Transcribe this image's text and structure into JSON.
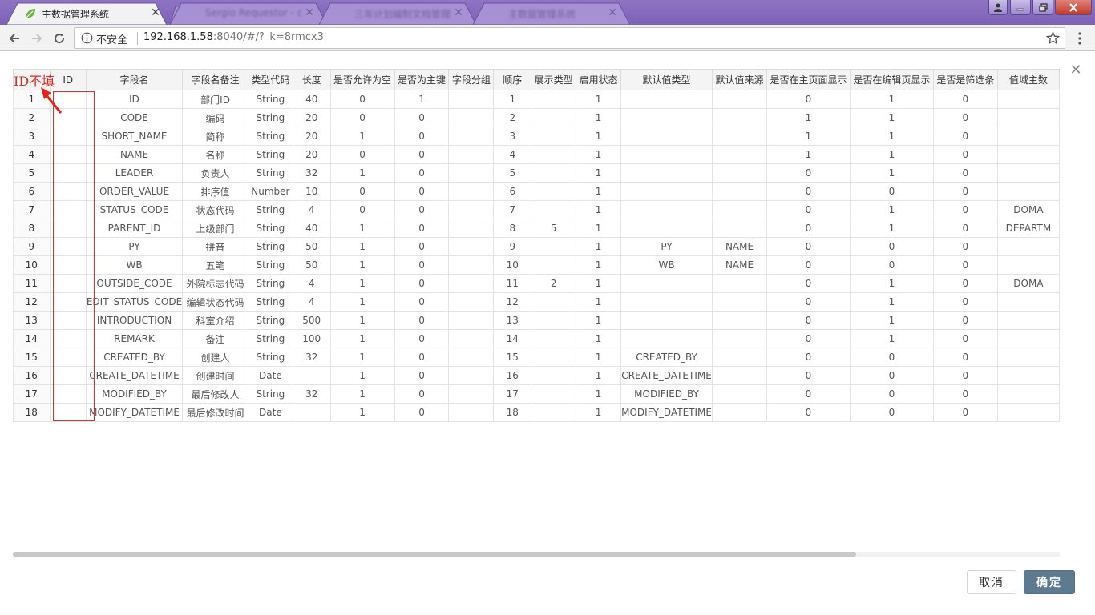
{
  "browser": {
    "tabs": [
      {
        "title": "主数据管理系统",
        "active": true
      },
      {
        "title": "Sergio Requestor - dev",
        "active": false
      },
      {
        "title": "三年计划编制文档管理",
        "active": false
      },
      {
        "title": "主数据管理系统",
        "active": false
      }
    ],
    "security_label": "不安全",
    "url_host": "192.168.1.58",
    "url_rest": ":8040/#/?_k=8rmcx3"
  },
  "annotation": {
    "text": "ID不填",
    "color": "#e0261f"
  },
  "table": {
    "columns": [
      "",
      "ID",
      "字段名",
      "字段名备注",
      "类型代码",
      "长度",
      "是否允许为空",
      "是否为主键",
      "字段分组",
      "顺序",
      "展示类型",
      "启用状态",
      "默认值类型",
      "默认值来源",
      "是否在主页面显示",
      "是否在编辑页显示",
      "是否是筛选条",
      "值域主数"
    ],
    "rows": [
      [
        "1",
        "",
        "ID",
        "部门ID",
        "String",
        "40",
        "0",
        "1",
        "",
        "1",
        "",
        "1",
        "",
        "",
        "0",
        "1",
        "0",
        ""
      ],
      [
        "2",
        "",
        "CODE",
        "编码",
        "String",
        "20",
        "0",
        "0",
        "",
        "2",
        "",
        "1",
        "",
        "",
        "1",
        "1",
        "0",
        ""
      ],
      [
        "3",
        "",
        "SHORT_NAME",
        "简称",
        "String",
        "20",
        "1",
        "0",
        "",
        "3",
        "",
        "1",
        "",
        "",
        "1",
        "1",
        "0",
        ""
      ],
      [
        "4",
        "",
        "NAME",
        "名称",
        "String",
        "20",
        "0",
        "0",
        "",
        "4",
        "",
        "1",
        "",
        "",
        "1",
        "1",
        "0",
        ""
      ],
      [
        "5",
        "",
        "LEADER",
        "负责人",
        "String",
        "32",
        "1",
        "0",
        "",
        "5",
        "",
        "1",
        "",
        "",
        "0",
        "1",
        "0",
        ""
      ],
      [
        "6",
        "",
        "ORDER_VALUE",
        "排序值",
        "Number",
        "10",
        "0",
        "0",
        "",
        "6",
        "",
        "1",
        "",
        "",
        "0",
        "0",
        "0",
        ""
      ],
      [
        "7",
        "",
        "STATUS_CODE",
        "状态代码",
        "String",
        "4",
        "0",
        "0",
        "",
        "7",
        "",
        "1",
        "",
        "",
        "0",
        "1",
        "0",
        "DOMA"
      ],
      [
        "8",
        "",
        "PARENT_ID",
        "上级部门",
        "String",
        "40",
        "1",
        "0",
        "",
        "8",
        "5",
        "1",
        "",
        "",
        "0",
        "1",
        "0",
        "DEPARTM"
      ],
      [
        "9",
        "",
        "PY",
        "拼音",
        "String",
        "50",
        "1",
        "0",
        "",
        "9",
        "",
        "1",
        "PY",
        "NAME",
        "0",
        "0",
        "0",
        ""
      ],
      [
        "10",
        "",
        "WB",
        "五笔",
        "String",
        "50",
        "1",
        "0",
        "",
        "10",
        "",
        "1",
        "WB",
        "NAME",
        "0",
        "0",
        "0",
        ""
      ],
      [
        "11",
        "",
        "OUTSIDE_CODE",
        "外院标志代码",
        "String",
        "4",
        "1",
        "0",
        "",
        "11",
        "2",
        "1",
        "",
        "",
        "0",
        "1",
        "0",
        "DOMA"
      ],
      [
        "12",
        "",
        "EDIT_STATUS_CODE",
        "编辑状态代码",
        "String",
        "4",
        "1",
        "0",
        "",
        "12",
        "",
        "1",
        "",
        "",
        "0",
        "1",
        "0",
        ""
      ],
      [
        "13",
        "",
        "INTRODUCTION",
        "科室介绍",
        "String",
        "500",
        "1",
        "0",
        "",
        "13",
        "",
        "1",
        "",
        "",
        "0",
        "1",
        "0",
        ""
      ],
      [
        "14",
        "",
        "REMARK",
        "备注",
        "String",
        "100",
        "1",
        "0",
        "",
        "14",
        "",
        "1",
        "",
        "",
        "0",
        "1",
        "0",
        ""
      ],
      [
        "15",
        "",
        "CREATED_BY",
        "创建人",
        "String",
        "32",
        "1",
        "0",
        "",
        "15",
        "",
        "1",
        "CREATED_BY",
        "",
        "0",
        "0",
        "0",
        ""
      ],
      [
        "16",
        "",
        "CREATE_DATETIME",
        "创建时间",
        "Date",
        "",
        "1",
        "0",
        "",
        "16",
        "",
        "1",
        "CREATE_DATETIME",
        "",
        "0",
        "0",
        "0",
        ""
      ],
      [
        "17",
        "",
        "MODIFIED_BY",
        "最后修改人",
        "String",
        "32",
        "1",
        "0",
        "",
        "17",
        "",
        "1",
        "MODIFIED_BY",
        "",
        "0",
        "0",
        "0",
        ""
      ],
      [
        "18",
        "",
        "MODIFY_DATETIME",
        "最后修改时间",
        "Date",
        "",
        "1",
        "0",
        "",
        "18",
        "",
        "1",
        "MODIFY_DATETIME",
        "",
        "0",
        "0",
        "0",
        ""
      ]
    ]
  },
  "footer": {
    "cancel_label": "取消",
    "ok_label": "确定"
  },
  "colors": {
    "titlebar": "#8f74c4",
    "ok_button": "#5d7a8e",
    "highlight": "#e02c2c"
  }
}
